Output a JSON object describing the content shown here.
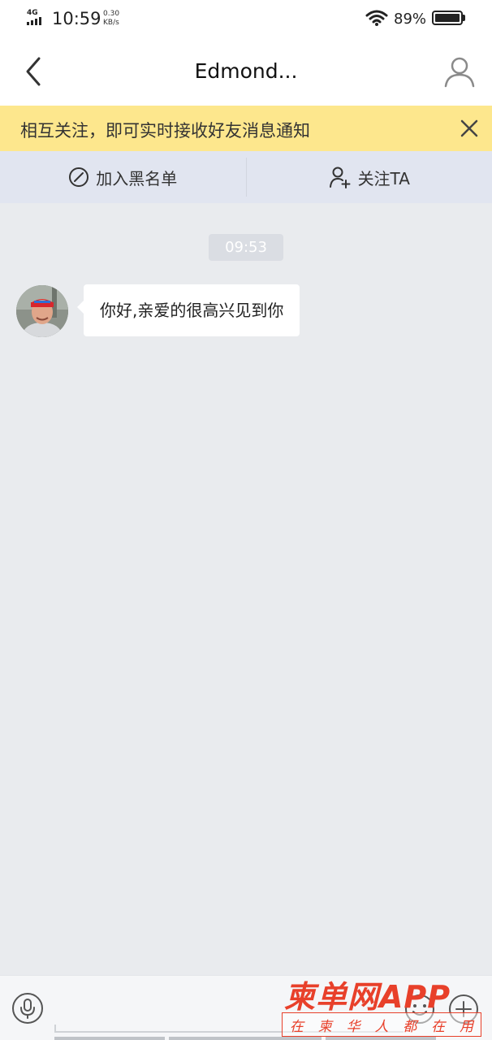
{
  "status_bar": {
    "network": "4G",
    "time": "10:59",
    "speed_value": "0.30",
    "speed_unit": "KB/s",
    "battery": "89%"
  },
  "nav": {
    "title": "Edmond...",
    "icons": {
      "back": "chevron-left-icon",
      "profile": "person-icon"
    }
  },
  "notice": {
    "text": "相互关注，即可实时接收好友消息通知",
    "bg_color": "#fde78d"
  },
  "actions": {
    "blacklist_label": "加入黑名单",
    "follow_label": "关注TA",
    "bg_color": "#e1e5f0"
  },
  "chat": {
    "timestamp": "09:53",
    "messages": [
      {
        "sender": "other",
        "text": "你好,亲爱的很高兴见到你"
      }
    ]
  },
  "input_bar": {
    "icons": {
      "voice": "microphone-icon",
      "emoji": "smiley-icon",
      "more": "plus-icon"
    }
  },
  "watermark": {
    "main": "柬单网APP",
    "sub": [
      "在",
      "柬",
      "华",
      "人",
      "都",
      "在",
      "用"
    ],
    "color": "#e8402a"
  }
}
